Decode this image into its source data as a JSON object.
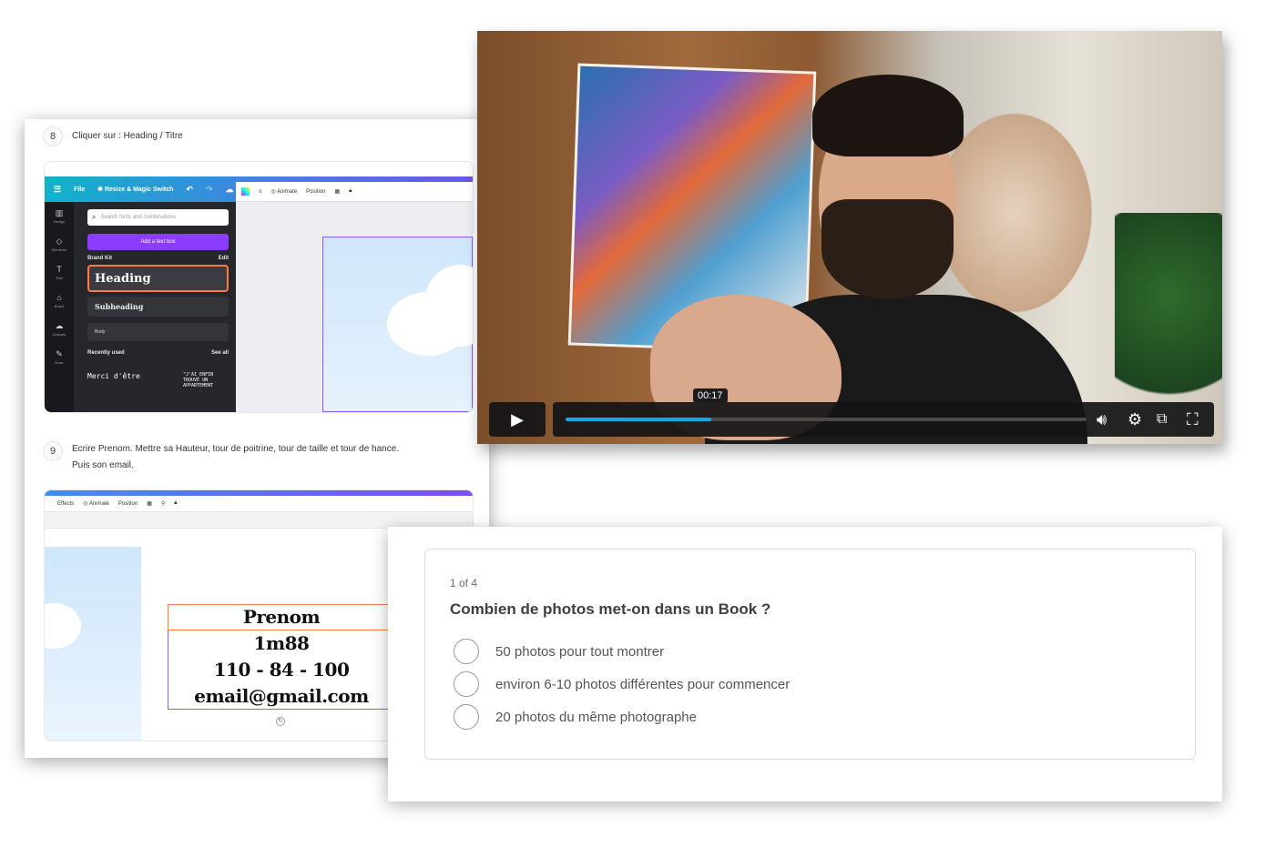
{
  "tutorial": {
    "step8": {
      "number": "8",
      "text": "Cliquer sur : Heading / Titre"
    },
    "step9": {
      "number": "9",
      "text": "Ecrire Prenom. Mettre sa Hauteur, tour de poitrine, tour de taille et tour de hance. Puis son email."
    },
    "canva1": {
      "topbar": {
        "file": "File",
        "resize": "Resize & Magic Switch"
      },
      "rail": [
        "Design",
        "Elements",
        "Text",
        "Brand",
        "Uploads",
        "Draw"
      ],
      "search_placeholder": "Search fonts and combinations",
      "add_textbox": "Add a text box",
      "brand_kit": "Brand Kit",
      "edit": "Edit",
      "heading": "Heading",
      "subheading": "Subheading",
      "body": "Body",
      "recently_used": "Recently used",
      "see_all": "See all",
      "font_sample_1": "Merci d'être",
      "font_sample_2": "\"J'AI ENFIN TROUVÉ UN APPARTEMENT",
      "toolbar": {
        "animate": "Animate",
        "position": "Position"
      }
    },
    "canva2": {
      "toolbar": {
        "effects": "Effects",
        "animate": "Animate",
        "position": "Position"
      },
      "lines": [
        "Prenom",
        "1m88",
        "110 - 84 - 100",
        "email@gmail.com"
      ]
    }
  },
  "video": {
    "timestamp": "00:17",
    "progress": 0.28,
    "accent": "#14a8e0"
  },
  "quiz": {
    "counter": "1 of 4",
    "question": "Combien de photos met-on dans un Book ?",
    "options": [
      "50 photos pour tout montrer",
      "environ 6-10 photos différentes pour commencer",
      "20 photos du même photographe"
    ]
  }
}
